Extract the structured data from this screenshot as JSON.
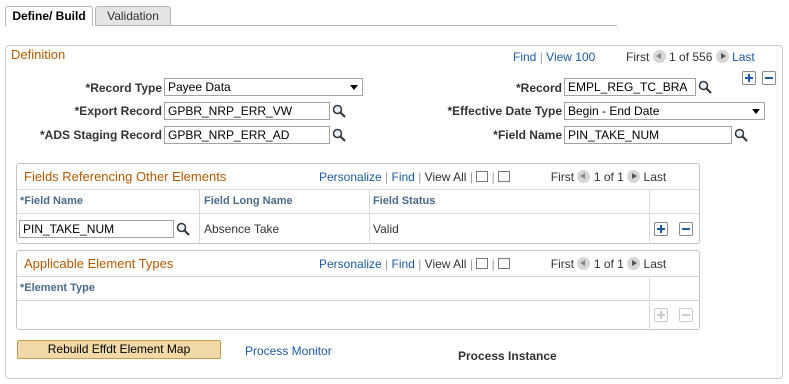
{
  "tabs": [
    {
      "label": "Define/ Build",
      "active": true
    },
    {
      "label": "Validation",
      "active": false
    }
  ],
  "definition": {
    "title": "Definition",
    "nav": {
      "find": "Find",
      "view": "View 100",
      "first": "First",
      "range": "1 of 556",
      "last": "Last"
    },
    "record_type": {
      "label": "*Record Type",
      "value": "Payee Data"
    },
    "export_record": {
      "label": "*Export Record",
      "value": "GPBR_NRP_ERR_VW"
    },
    "ads_staging_record": {
      "label": "*ADS Staging Record",
      "value": "GPBR_NRP_ERR_AD"
    },
    "record": {
      "label": "*Record",
      "value": "EMPL_REG_TC_BRA"
    },
    "effective_date_type": {
      "label": "*Effective Date Type",
      "value": "Begin - End Date"
    },
    "field_name": {
      "label": "*Field Name",
      "value": "PIN_TAKE_NUM"
    }
  },
  "fields_grid": {
    "title": "Fields Referencing Other Elements",
    "nav": {
      "personalize": "Personalize",
      "find": "Find",
      "view_all": "View All",
      "first": "First",
      "range": "1 of 1",
      "last": "Last"
    },
    "columns": [
      "*Field Name",
      "Field Long Name",
      "Field Status"
    ],
    "rows": [
      {
        "field_name": "PIN_TAKE_NUM",
        "long_name": "Absence Take",
        "status": "Valid"
      }
    ]
  },
  "element_types_grid": {
    "title": "Applicable Element Types",
    "nav": {
      "personalize": "Personalize",
      "find": "Find",
      "view_all": "View All",
      "first": "First",
      "range": "1 of 1",
      "last": "Last"
    },
    "columns": [
      "*Element Type"
    ]
  },
  "footer": {
    "rebuild_button": "Rebuild Effdt Element Map",
    "process_monitor": "Process Monitor",
    "process_instance": "Process Instance"
  }
}
